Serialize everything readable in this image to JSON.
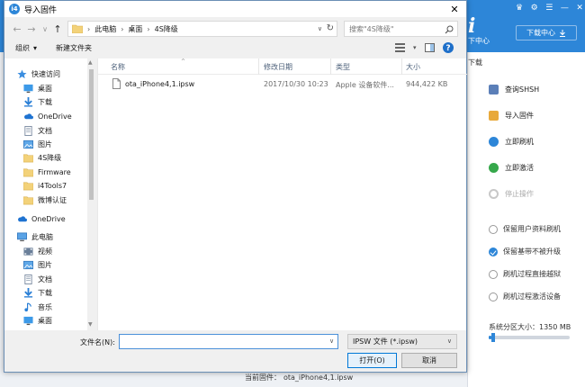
{
  "background_app": {
    "header_color": "#2d86d8",
    "window_controls": [
      "♛",
      "⚙",
      "☰",
      "—",
      "✕"
    ],
    "logo_glyph": "i",
    "logo_sub": "下中心",
    "download_center": "下载中心",
    "download_icon": "download-icon",
    "tab_partial": "下载",
    "actions": [
      {
        "label": "查询SHSH",
        "icon": "search-shsh-icon",
        "color": "#5b7fb8",
        "enabled": true
      },
      {
        "label": "导入固件",
        "icon": "import-firmware-icon",
        "color": "#e8a93b",
        "enabled": true
      },
      {
        "label": "立即刷机",
        "icon": "flash-now-icon",
        "color": "#2d86d8",
        "enabled": true
      },
      {
        "label": "立即激活",
        "icon": "activate-now-icon",
        "color": "#36a84b",
        "enabled": true
      },
      {
        "label": "停止操作",
        "icon": "stop-icon",
        "color": "#c8c8c8",
        "enabled": false
      }
    ],
    "options": [
      {
        "label": "保留用户资料刷机",
        "checked": false
      },
      {
        "label": "保留基带不被升级",
        "checked": true
      },
      {
        "label": "刷机过程直接越狱",
        "checked": false
      },
      {
        "label": "刷机过程激活设备",
        "checked": false
      }
    ],
    "partition_label": "系统分区大小：1350 MB",
    "partition_level": 0.03,
    "current_firmware_label": "当前固件：",
    "current_firmware_value": "ota_iPhone4,1.ipsw"
  },
  "dialog": {
    "title": "导入固件",
    "app_icon_glyph": "i4",
    "close_glyph": "✕",
    "nav": {
      "back": "←",
      "forward": "→",
      "dropdown": "∨",
      "up": "↑"
    },
    "breadcrumb": [
      "此电脑",
      "桌面",
      "4S降级"
    ],
    "breadcrumb_sep": "›",
    "search_placeholder": "搜索\"4S降级\"",
    "toolbar": {
      "organize": "组织",
      "organize_arrow": "▾",
      "new_folder": "新建文件夹"
    },
    "tree": [
      {
        "label": "快速访问",
        "icon": "star-icon",
        "indent": 1,
        "section": true,
        "pinned": false
      },
      {
        "label": "桌面",
        "icon": "desktop-icon",
        "indent": 2,
        "pinned": true
      },
      {
        "label": "下载",
        "icon": "download-arrow-icon",
        "indent": 2,
        "pinned": true
      },
      {
        "label": "OneDrive",
        "icon": "cloud-icon",
        "indent": 2,
        "pinned": true
      },
      {
        "label": "文档",
        "icon": "documents-icon",
        "indent": 2,
        "pinned": true
      },
      {
        "label": "图片",
        "icon": "pictures-icon",
        "indent": 2,
        "pinned": true
      },
      {
        "label": "4S降级",
        "icon": "folder-icon",
        "indent": 2,
        "pinned": false
      },
      {
        "label": "Firmware",
        "icon": "folder-icon",
        "indent": 2,
        "pinned": false
      },
      {
        "label": "i4Tools7",
        "icon": "folder-icon",
        "indent": 2,
        "pinned": false
      },
      {
        "label": "微博认证",
        "icon": "folder-icon",
        "indent": 2,
        "pinned": false
      },
      {
        "label": "OneDrive",
        "icon": "cloud-icon",
        "indent": 1,
        "section": true,
        "pinned": false
      },
      {
        "label": "此电脑",
        "icon": "computer-icon",
        "indent": 1,
        "section": true,
        "pinned": false
      },
      {
        "label": "视频",
        "icon": "video-icon",
        "indent": 2,
        "pinned": false
      },
      {
        "label": "图片",
        "icon": "pictures-icon",
        "indent": 2,
        "pinned": false
      },
      {
        "label": "文档",
        "icon": "documents-icon",
        "indent": 2,
        "pinned": false
      },
      {
        "label": "下载",
        "icon": "download-arrow-icon",
        "indent": 2,
        "pinned": false
      },
      {
        "label": "音乐",
        "icon": "music-icon",
        "indent": 2,
        "pinned": false
      },
      {
        "label": "桌面",
        "icon": "desktop-icon",
        "indent": 2,
        "pinned": false
      }
    ],
    "columns": [
      "名称",
      "修改日期",
      "类型",
      "大小"
    ],
    "files": [
      {
        "name": "ota_iPhone4,1.ipsw",
        "modified": "2017/10/30 10:23",
        "type": "Apple 设备软件...",
        "size": "944,422 KB"
      }
    ],
    "filename_label": "文件名(N):",
    "filename_value": "",
    "filetype": "IPSW 文件 (*.ipsw)",
    "open_button": "打开(O)",
    "cancel_button": "取消"
  }
}
